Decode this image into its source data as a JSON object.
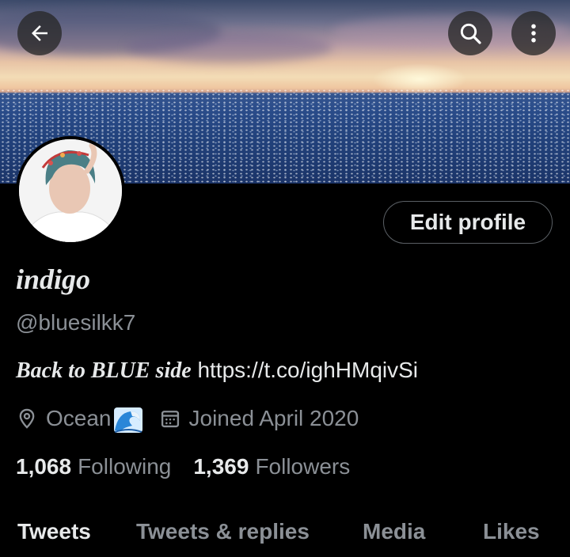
{
  "header": {
    "back_icon": "arrow-left-icon",
    "search_icon": "search-icon",
    "more_icon": "more-vertical-icon"
  },
  "profile": {
    "edit_label": "Edit profile",
    "display_name": "indigo",
    "handle": "@bluesilkk7",
    "bio_text": "Back to BLUE side",
    "bio_link": "https://t.co/ighHMqivSi",
    "location": "Ocean",
    "location_emoji": "water-wave-emoji",
    "joined": "Joined April 2020"
  },
  "stats": {
    "following_count": "1,068",
    "following_label": "Following",
    "followers_count": "1,369",
    "followers_label": "Followers"
  },
  "tabs": [
    {
      "label": "Tweets",
      "active": true
    },
    {
      "label": "Tweets & replies",
      "active": false
    },
    {
      "label": "Media",
      "active": false
    },
    {
      "label": "Likes",
      "active": false
    }
  ],
  "colors": {
    "background": "#000000",
    "primary_text": "#e7e9ea",
    "secondary_text": "#8b9096",
    "button_border": "#5a5f64"
  }
}
